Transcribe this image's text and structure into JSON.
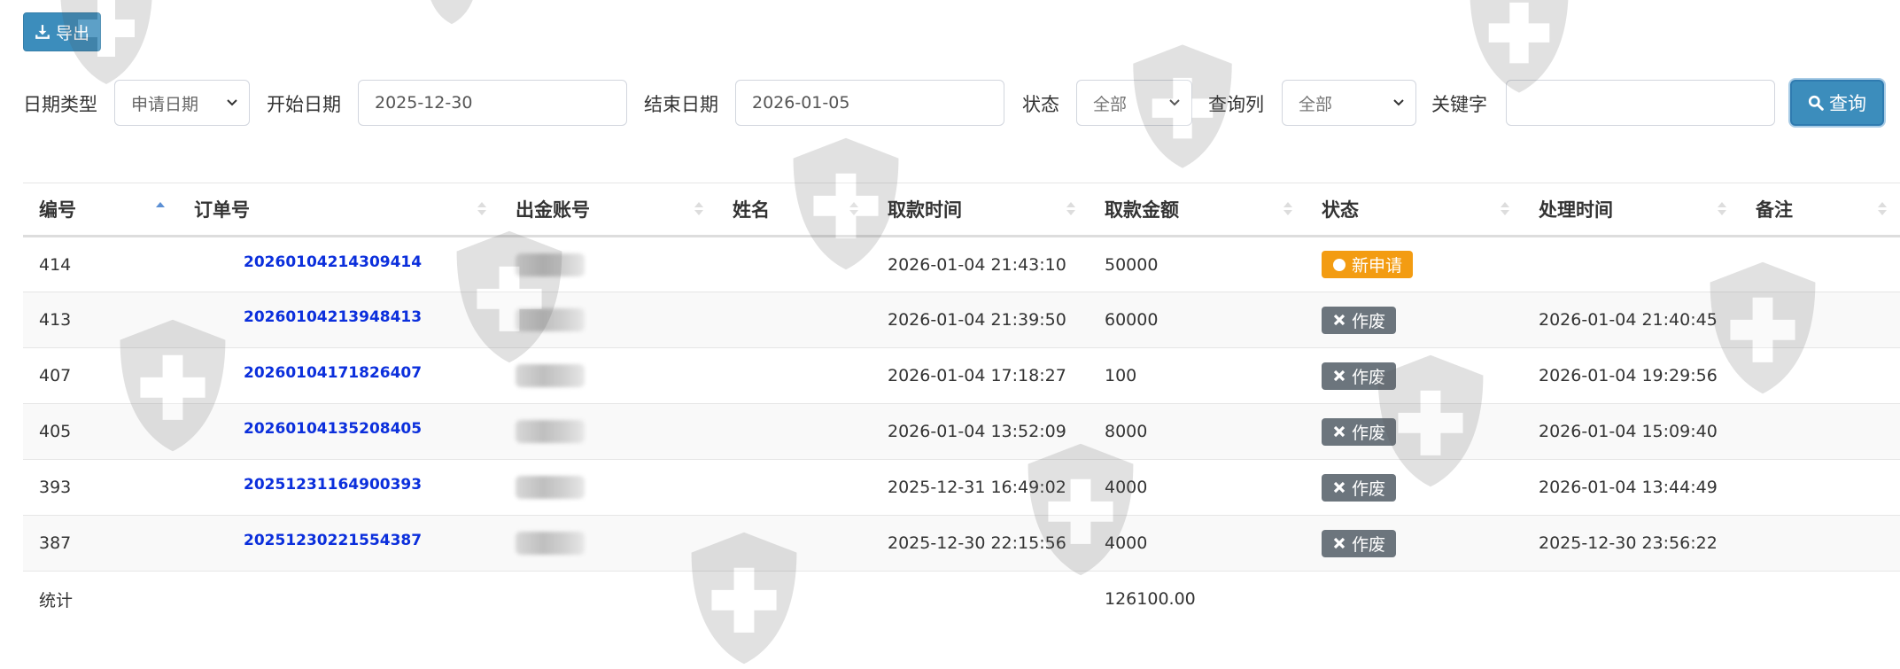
{
  "toolbar": {
    "export_label": "导出",
    "export_icon": "download-icon"
  },
  "filters": {
    "date_type_label": "日期类型",
    "date_type_value": "申请日期",
    "start_label": "开始日期",
    "start_value": "2025-12-30",
    "end_label": "结束日期",
    "end_value": "2026-01-05",
    "status_label": "状态",
    "status_value": "全部",
    "column_label": "查询列",
    "column_value": "全部",
    "keyword_label": "关键字",
    "keyword_value": "",
    "search_label": "查询",
    "search_icon": "search-icon"
  },
  "table": {
    "headers": [
      "编号",
      "订单号",
      "出金账号",
      "姓名",
      "取款时间",
      "取款金额",
      "状态",
      "处理时间",
      "备注"
    ],
    "rows": [
      {
        "id": "414",
        "order": "20260104214309414",
        "time": "2026-01-04 21:43:10",
        "amount": "50000",
        "status": "新申请",
        "status_type": "new",
        "processed": ""
      },
      {
        "id": "413",
        "order": "20260104213948413",
        "time": "2026-01-04 21:39:50",
        "amount": "60000",
        "status": "作废",
        "status_type": "void",
        "processed": "2026-01-04 21:40:45"
      },
      {
        "id": "407",
        "order": "20260104171826407",
        "time": "2026-01-04 17:18:27",
        "amount": "100",
        "status": "作废",
        "status_type": "void",
        "processed": "2026-01-04 19:29:56"
      },
      {
        "id": "405",
        "order": "20260104135208405",
        "time": "2026-01-04 13:52:09",
        "amount": "8000",
        "status": "作废",
        "status_type": "void",
        "processed": "2026-01-04 15:09:40"
      },
      {
        "id": "393",
        "order": "20251231164900393",
        "time": "2025-12-31 16:49:02",
        "amount": "4000",
        "status": "作废",
        "status_type": "void",
        "processed": "2026-01-04 13:44:49"
      },
      {
        "id": "387",
        "order": "20251230221554387",
        "time": "2025-12-30 22:15:56",
        "amount": "4000",
        "status": "作废",
        "status_type": "void",
        "processed": "2025-12-30 23:56:22"
      }
    ],
    "footer": {
      "label": "统计",
      "total": "126100.00"
    }
  },
  "colors": {
    "primary": "#3c8dbc",
    "order_link": "#0b2fdc",
    "badge_new": "#f39c12",
    "badge_void": "#6c757d",
    "total": "#1e8a1e"
  }
}
